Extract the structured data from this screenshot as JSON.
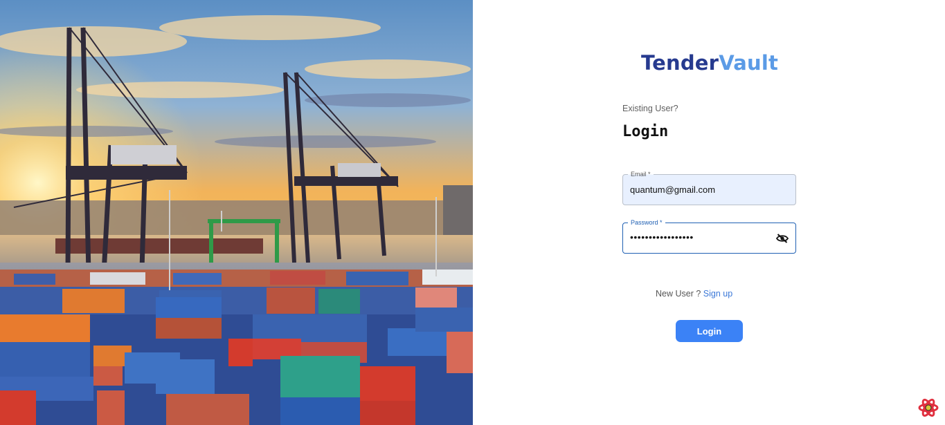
{
  "brand": {
    "part1": "Tender",
    "part2": "Vault"
  },
  "login": {
    "subtitle": "Existing User?",
    "heading": "Login",
    "email": {
      "label": "Email *",
      "value": "quantum@gmail.com"
    },
    "password": {
      "label": "Password *",
      "value": "•••••••••••••••••"
    },
    "signup_prompt": "New User ?",
    "signup_link": "Sign up",
    "submit_label": "Login"
  },
  "icons": {
    "password_toggle": "eye-off-icon",
    "dev_badge": "react-logo-icon"
  },
  "colors": {
    "brand_dark": "#263a8f",
    "brand_light": "#5b9be6",
    "primary_button": "#3b82f6",
    "link": "#3b78d8",
    "focus_border": "#1e5fb3",
    "autofill_bg": "#e8f0fe"
  }
}
